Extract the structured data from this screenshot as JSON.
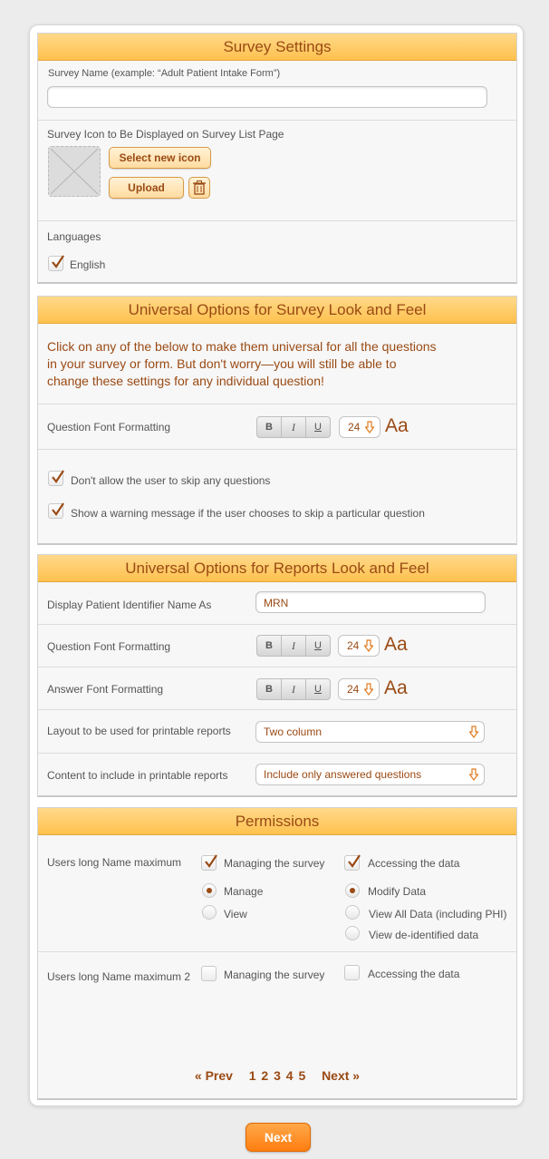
{
  "survey_settings": {
    "header": "Survey Settings",
    "name_label": "Survey Name (example: “Adult Patient Intake Form”)",
    "name_value": "",
    "icon_label": "Survey Icon to Be Displayed on Survey List Page",
    "select_icon_button": "Select new icon",
    "upload_button": "Upload",
    "languages_label": "Languages",
    "language_option": "English"
  },
  "survey_look": {
    "header": "Universal Options for Survey Look and Feel",
    "intro": "Click on any of the below to make them universal for all the questions in your survey or form. But don't worry—you will still be able to change these settings for any individual question!",
    "question_font_label": "Question Font Formatting",
    "question_font_size": "24",
    "skip_option": "Don't allow the user to skip any questions",
    "warning_option": "Show a warning message if the user chooses to skip a particular question"
  },
  "format_buttons": {
    "bold": "B",
    "italic": "I",
    "underline": "U",
    "sample": "Aa"
  },
  "reports_look": {
    "header": "Universal Options for Reports Look and Feel",
    "patient_id_label": "Display Patient Identifier Name As",
    "patient_id_value": "MRN",
    "question_font_label": "Question Font Formatting",
    "question_font_size": "24",
    "answer_font_label": "Answer Font Formatting",
    "answer_font_size": "24",
    "layout_label": "Layout to be used for printable reports",
    "layout_value": "Two column",
    "content_label": "Content to include in printable reports",
    "content_value": "Include only answered questions"
  },
  "permissions": {
    "header": "Permissions",
    "users": [
      {
        "name": "Users long Name maximum",
        "managing_label": "Managing the survey",
        "accessing_label": "Accessing the data",
        "manage_option": "Manage",
        "view_option": "View",
        "modify_option": "Modify Data",
        "view_all_option": "View All Data (including PHI)",
        "deidentified_option": "View de-identified data"
      },
      {
        "name": "Users long Name maximum 2",
        "managing_label": "Managing the survey",
        "accessing_label": "Accessing the data"
      }
    ],
    "pager": {
      "prev": "« Prev",
      "pages": [
        "1",
        "2",
        "3",
        "4",
        "5"
      ],
      "next": "Next »"
    }
  },
  "next_button": "Next",
  "colors": {
    "accent": "#9a4a14",
    "header_bg": "#ffc14e",
    "primary_button": "#ff8a1f"
  }
}
